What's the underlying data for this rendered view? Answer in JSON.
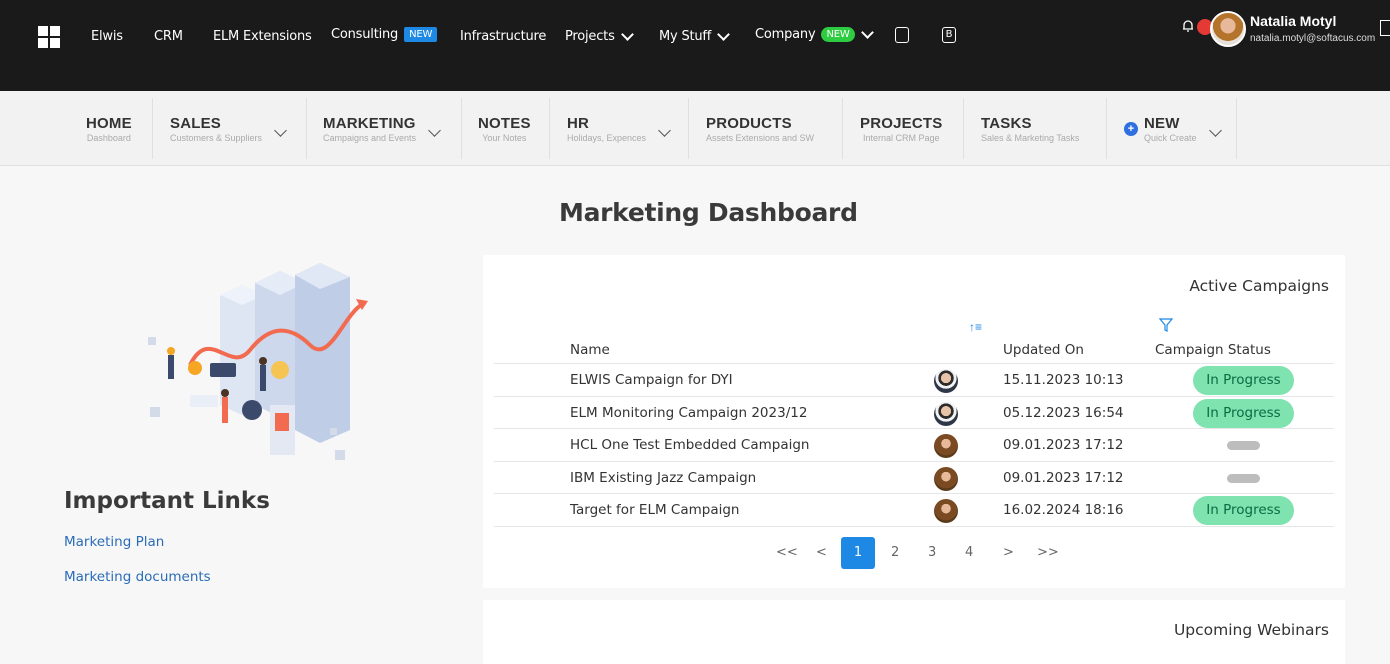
{
  "topnav": {
    "items": [
      {
        "label": "Elwis"
      },
      {
        "label": "CRM"
      },
      {
        "label": "ELM Extensions"
      },
      {
        "label": "Consulting",
        "badge": "NEW"
      },
      {
        "label": "Infrastructure"
      },
      {
        "label": "Projects"
      },
      {
        "label": "My Stuff"
      },
      {
        "label": "Company",
        "badge": "NEW"
      }
    ],
    "icon_b_label": "B",
    "user": {
      "name": "Natalia Motyl",
      "email": "natalia.motyl@softacus.com"
    },
    "colors": {
      "background": "#1a1a1a",
      "badge_blue": "#1e88e5",
      "badge_green": "#2ecc40"
    }
  },
  "menu": {
    "items": [
      {
        "title": "HOME",
        "subtitle": "Dashboard"
      },
      {
        "title": "SALES",
        "subtitle": "Customers & Suppliers"
      },
      {
        "title": "MARKETING",
        "subtitle": "Campaigns and Events"
      },
      {
        "title": "NOTES",
        "subtitle": "Your Notes"
      },
      {
        "title": "HR",
        "subtitle": "Holidays, Expences"
      },
      {
        "title": "PRODUCTS",
        "subtitle": "Assets Extensions and SW"
      },
      {
        "title": "PROJECTS",
        "subtitle": "Internal CRM Page"
      },
      {
        "title": "TASKS",
        "subtitle": "Sales & Marketing Tasks"
      },
      {
        "title": "NEW",
        "subtitle": "Quick Create"
      }
    ]
  },
  "page": {
    "title": "Marketing Dashboard"
  },
  "links": {
    "title": "Important Links",
    "items": [
      "Marketing Plan",
      "Marketing documents"
    ]
  },
  "campaigns": {
    "title": "Active Campaigns",
    "headers": {
      "name": "Name",
      "updated": "Updated On",
      "status": "Campaign Status"
    },
    "rows": [
      {
        "name": "ELWIS Campaign for DYI",
        "avatar": "male-avatar",
        "updated": "15.11.2023 10:13",
        "status": "In Progress"
      },
      {
        "name": "ELM Monitoring Campaign 2023/12",
        "avatar": "male-avatar",
        "updated": "05.12.2023 16:54",
        "status": "In Progress"
      },
      {
        "name": "HCL One Test Embedded Campaign",
        "avatar": "female-avatar",
        "updated": "09.01.2023 17:12",
        "status": ""
      },
      {
        "name": "IBM Existing Jazz Campaign",
        "avatar": "female-avatar",
        "updated": "09.01.2023 17:12",
        "status": ""
      },
      {
        "name": "Target for ELM Campaign",
        "avatar": "female-avatar",
        "updated": "16.02.2024 18:16",
        "status": "In Progress"
      }
    ],
    "pagination": {
      "first": "<<",
      "prev": "<",
      "pages": [
        "1",
        "2",
        "3",
        "4"
      ],
      "current": "1",
      "next": ">",
      "last": ">>"
    },
    "colors": {
      "status_bg": "#7ee3af",
      "status_text": "#0b6b42",
      "empty_status": "#bdbdbd"
    }
  },
  "webinars": {
    "title": "Upcoming Webinars"
  }
}
